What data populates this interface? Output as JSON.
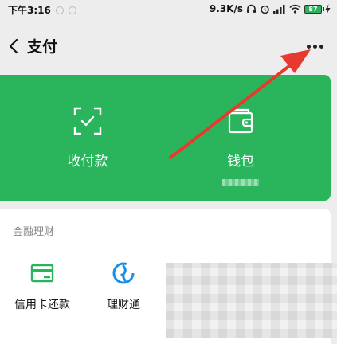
{
  "status_bar": {
    "time": "下午3:16",
    "network_speed": "9.3K/s",
    "battery_level": "87"
  },
  "header": {
    "title": "支付"
  },
  "pay_card": {
    "color": "#2ab55c",
    "receive_pay_label": "收付款",
    "wallet_label": "钱包"
  },
  "finance": {
    "section_title": "金融理财",
    "items": [
      {
        "label": "信用卡还款",
        "icon": "credit-card-icon"
      },
      {
        "label": "理财通",
        "icon": "wealth-icon"
      }
    ]
  },
  "annotation": {
    "arrow_color": "#e8392f"
  }
}
